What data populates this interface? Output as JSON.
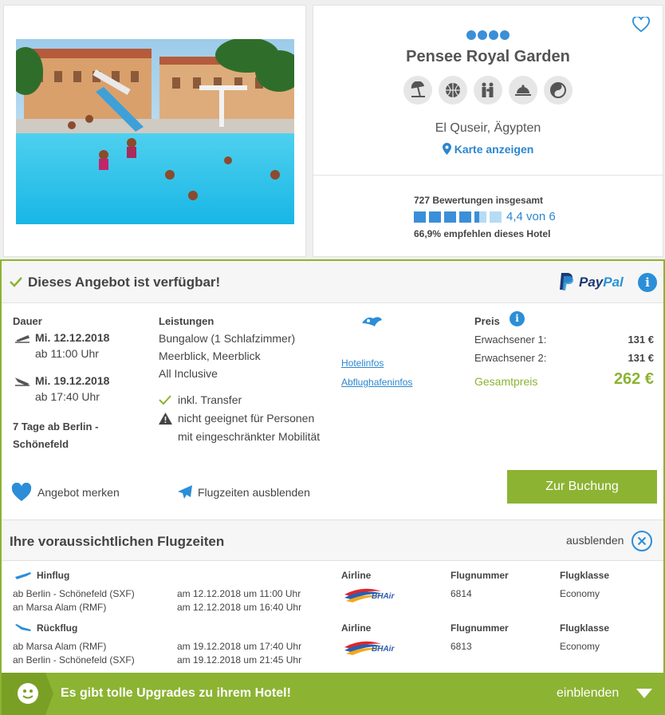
{
  "hotel": {
    "name": "Pensee Royal Garden",
    "stars": 4,
    "location": "El Quseir, Ägypten",
    "map_link": "Karte anzeigen",
    "amenities": [
      "beach-icon",
      "sports-ball-icon",
      "family-icon",
      "dining-icon",
      "wellness-icon"
    ]
  },
  "reviews": {
    "total": "727 Bewertungen insgesamt",
    "score": "4,4 von 6",
    "score_value": 4.4,
    "score_max": 6,
    "recommend": "66,9% empfehlen dieses Hotel"
  },
  "offer": {
    "available": "Dieses Angebot ist verfügbar!",
    "paypal_pay": "Pay",
    "paypal_pal": "Pal",
    "duration_label": "Dauer",
    "outbound_date": "Mi. 12.12.2018",
    "outbound_time": "ab 11:00 Uhr",
    "return_date": "Mi. 19.12.2018",
    "return_time": "ab 17:40 Uhr",
    "summary_line1": "7 Tage ab Berlin -",
    "summary_line2": "Schönefeld",
    "services_label": "Leistungen",
    "services": [
      "Bungalow (1 Schlafzimmer)",
      "Meerblick, Meerblick",
      "All Inclusive"
    ],
    "transfer": "inkl. Transfer",
    "mobility_line1": "nicht geeignet für Personen",
    "mobility_line2": "mit eingeschränkter Mobilität",
    "hotel_info_link": "Hotelinfos",
    "airport_info_link": "Abflughafeninfos",
    "price_label": "Preis",
    "adult1_label": "Erwachsener 1:",
    "adult1_price": "131 €",
    "adult2_label": "Erwachsener 2:",
    "adult2_price": "131 €",
    "total_label": "Gesamtpreis",
    "total_price": "262 €",
    "save_label": "Angebot merken",
    "hide_flights_label": "Flugzeiten ausblenden",
    "book_button": "Zur Buchung"
  },
  "flights": {
    "title": "Ihre voraussichtlichen Flugzeiten",
    "hide_label": "ausblenden",
    "col_airline": "Airline",
    "col_number": "Flugnummer",
    "col_class": "Flugklasse",
    "outbound": {
      "label": "Hinflug",
      "from": "ab Berlin - Schönefeld (SXF)",
      "to": "an Marsa Alam (RMF)",
      "dep_time": "am 12.12.2018 um 11:00 Uhr",
      "arr_time": "am 12.12.2018 um 16:40 Uhr",
      "airline_logo_text": "BHAir",
      "number": "6814",
      "class": "Economy"
    },
    "inbound": {
      "label": "Rückflug",
      "from": "ab Marsa Alam (RMF)",
      "to": "an Berlin - Schönefeld (SXF)",
      "dep_time": "am 19.12.2018 um 17:40 Uhr",
      "arr_time": "am 19.12.2018 um 21:45 Uhr",
      "airline_logo_text": "BHAir",
      "number": "6813",
      "class": "Economy"
    }
  },
  "upgrade": {
    "text": "Es gibt tolle Upgrades zu ihrem Hotel!",
    "show_label": "einblenden"
  },
  "colors": {
    "accent_green": "#8cb332",
    "accent_blue": "#2c8ed8"
  }
}
